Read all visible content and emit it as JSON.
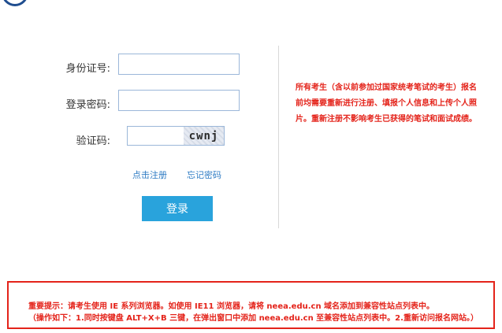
{
  "form": {
    "id_label": "身份证号:",
    "id_value": "",
    "password_label": "登录密码:",
    "password_value": "",
    "captcha_label": "验证码:",
    "captcha_value": "",
    "captcha_text": "cwnj",
    "register_link": "点击注册",
    "forgot_link": "忘记密码",
    "login_button": "登录"
  },
  "notice": {
    "text": "所有考生（含以前参加过国家统考笔试的考生）报名前均需要重新进行注册、填报个人信息和上传个人照片。重新注册不影响考生已获得的笔试和面试成绩。"
  },
  "warning": {
    "line1": "重要提示：请考生使用 IE 系列浏览器。如使用 IE11 浏览器，请将 neea.edu.cn 域名添加到兼容性站点列表中。",
    "line2": "（操作如下：1.同时按键盘 ALT+X+B 三键，在弹出窗口中添加 neea.edu.cn 至兼容性站点列表中。2.重新访问报名网站。）"
  },
  "colors": {
    "accent": "#29a3dc",
    "link": "#2f7cc4",
    "warning": "#e4231a",
    "input_border": "#9bb7d9"
  }
}
